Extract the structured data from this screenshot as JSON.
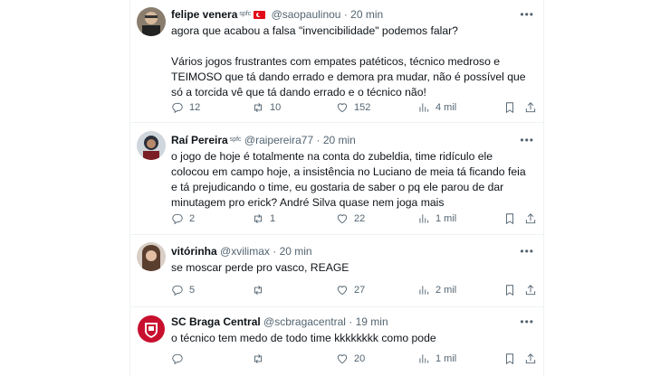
{
  "tweets": [
    {
      "name": "felipe venera",
      "badge": "spfc",
      "handle": "@saopaulinou",
      "dot": "·",
      "time": "20 min",
      "text_lines": [
        "agora que acabou a falsa \"invencibilidade\" podemos falar?",
        "",
        "Vários jogos frustrantes com empates patéticos, técnico medroso e TEIMOSO que tá dando errado e demora pra mudar, não é possível que só a torcida vê que tá dando errado e o técnico não!"
      ],
      "replies": "12",
      "retweets": "10",
      "likes": "152",
      "views": "4 mil"
    },
    {
      "name": "Raí Pereira",
      "badge": "spfc",
      "handle": "@raipereira77",
      "dot": "·",
      "time": "20 min",
      "text_lines": [
        "o jogo de hoje é totalmente na conta do zubeldia, time ridículo ele colocou em campo hoje, a insistência no Luciano de meia tá ficando feia e tá prejudicando o time, eu gostaria de saber o pq ele parou de dar minutagem pro erick? André Silva quase nem joga mais"
      ],
      "replies": "2",
      "retweets": "1",
      "likes": "22",
      "views": "1 mil"
    },
    {
      "name": "vitórinha",
      "handle": "@xvilimax",
      "dot": "·",
      "time": "20 min",
      "text_lines": [
        "se moscar perde pro vasco, REAGE"
      ],
      "replies": "5",
      "retweets": "",
      "likes": "27",
      "views": "2 mil"
    },
    {
      "name": "SC Braga Central",
      "handle": "@scbragacentral",
      "dot": "·",
      "time": "19 min",
      "text_lines": [
        "o técnico tem medo de todo time kkkkkkkk como pode"
      ],
      "replies": "",
      "retweets": "",
      "likes": "20",
      "views": "1 mil"
    }
  ],
  "icons": {
    "more": "more-options-icon",
    "reply": "reply-icon",
    "retweet": "retweet-icon",
    "like": "heart-icon",
    "views": "views-icon",
    "bookmark": "bookmark-icon",
    "share": "share-icon"
  },
  "colors": {
    "text": "#0f1419",
    "secondary": "#536471",
    "divider": "#eff3f4",
    "flag": "#e30a17"
  }
}
